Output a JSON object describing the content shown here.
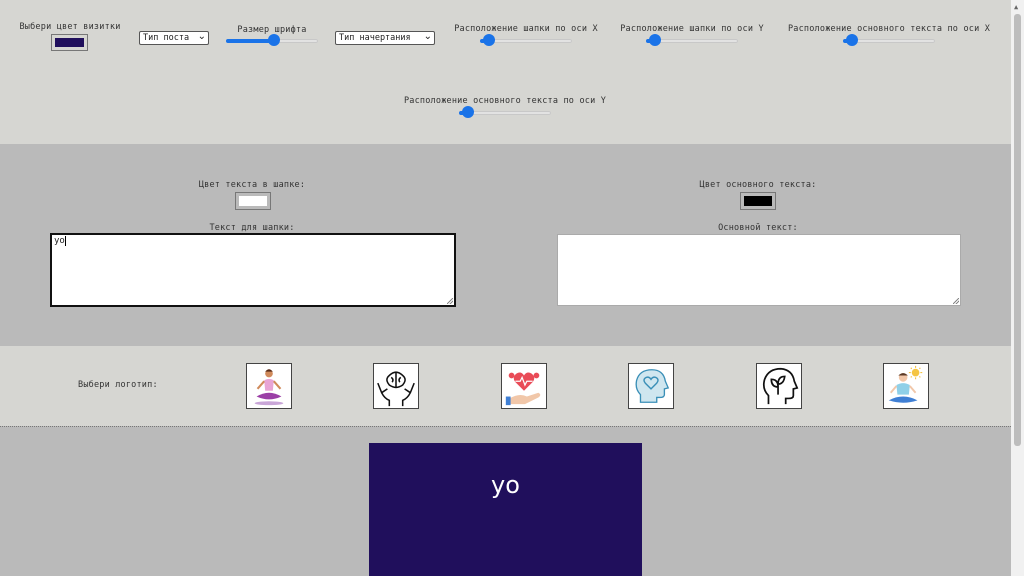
{
  "controls": {
    "card_color_label": "Выбери цвет визитки",
    "card_color": "#200f5c",
    "post_type_selected": "Тип поста",
    "font_size_label": "Размер шрифта",
    "font_size_value": 0.52,
    "style_type_selected": "Тип начертания",
    "header_x_label": "Расположение шапки по оси X",
    "header_x_value": 0.1,
    "header_y_label": "Расположение шапки по оси Y",
    "header_y_value": 0.1,
    "body_x_label": "Расположение основного текста по оси X",
    "body_x_value": 0.1,
    "body_y_label": "Расположение основного текста по оси Y",
    "body_y_value": 0.1
  },
  "text_settings": {
    "header_color_label": "Цвет текста в шапке:",
    "header_color": "#ffffff",
    "body_color_label": "Цвет основного текста:",
    "body_color": "#000000",
    "header_text_label": "Текст для шапки:",
    "header_text_value": "yo",
    "body_text_label": "Основной текст:",
    "body_text_value": ""
  },
  "logos": {
    "label": "Выбери логотип:",
    "items": [
      "yoga-pose-icon",
      "brain-hands-icon",
      "heart-care-icon",
      "head-heart-icon",
      "head-plant-icon",
      "meditation-sun-icon"
    ]
  },
  "preview": {
    "header_text": "yo",
    "background": "#200f5c",
    "text_color": "#ffffff"
  }
}
